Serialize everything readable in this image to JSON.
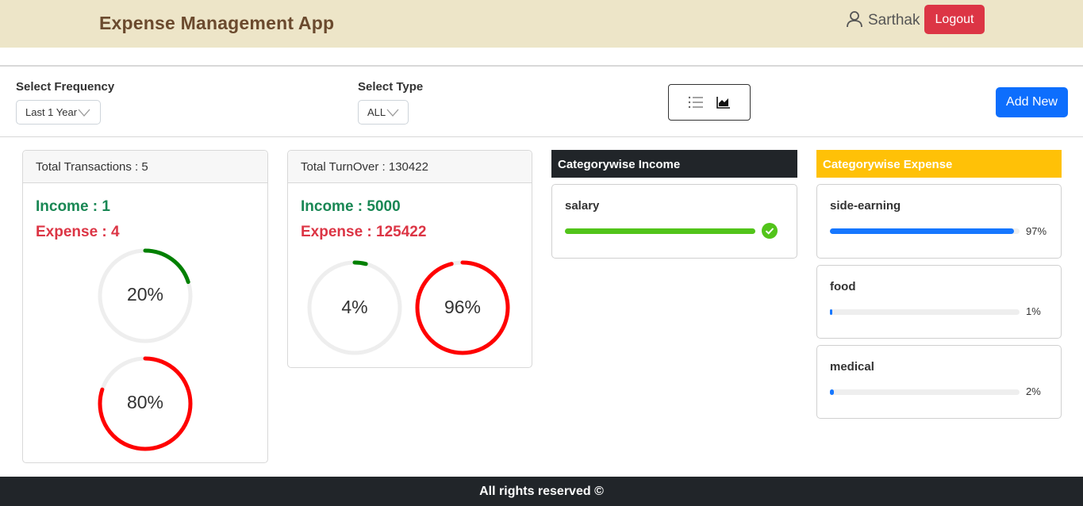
{
  "header": {
    "title": "Expense Management App",
    "user_name": "Sarthak",
    "logout_label": "Logout"
  },
  "filters": {
    "frequency_label": "Select Frequency",
    "frequency_value": "Last 1 Year",
    "type_label": "Select Type",
    "type_value": "ALL",
    "view_icons": [
      "list-icon",
      "area-chart-icon"
    ],
    "add_label": "Add New"
  },
  "transactions_card": {
    "header": "Total Transactions : 5",
    "income": "Income : 1",
    "expense": "Expense : 4",
    "income_pct_label": "20%",
    "income_pct": 0.2,
    "expense_pct_label": "80%",
    "expense_pct": 0.8
  },
  "turnover_card": {
    "header": "Total TurnOver : 130422",
    "income": "Income : 5000",
    "expense": "Expense : 125422",
    "income_pct_label": "4%",
    "income_pct": 0.04,
    "expense_pct_label": "96%",
    "expense_pct": 0.96
  },
  "category_income": {
    "title": "Categorywise Income",
    "items": [
      {
        "name": "salary",
        "fraction": 1.0,
        "complete": true
      }
    ]
  },
  "category_expense": {
    "title": "Categorywise Expense",
    "items": [
      {
        "name": "side-earning",
        "pct_label": "97%",
        "fraction": 0.97
      },
      {
        "name": "food",
        "pct_label": "1%",
        "fraction": 0.01
      },
      {
        "name": "medical",
        "pct_label": "2%",
        "fraction": 0.02
      }
    ]
  },
  "footer": {
    "text": "All rights reserved ©"
  },
  "colors": {
    "header_bg": "#ede5c8",
    "title": "#6b4a2e",
    "income_ring": "#008000",
    "expense_ring": "#ff0000",
    "ring_track": "#eeeeee",
    "success_bar": "#52c41a",
    "progress_bar": "#1677ff",
    "danger": "#dc3545",
    "primary": "#0d6efd",
    "warning": "#ffc107"
  }
}
